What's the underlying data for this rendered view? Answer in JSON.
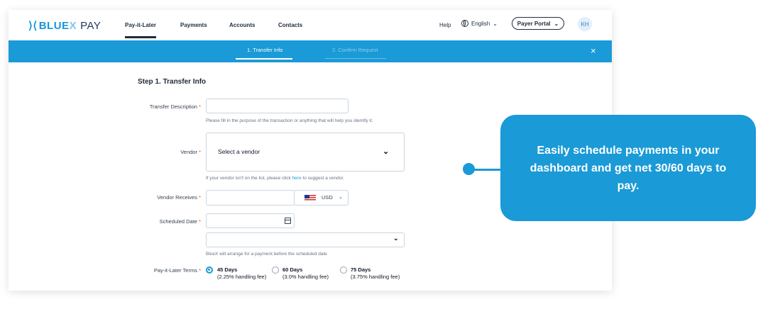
{
  "brand": {
    "name_blue": "BLUE",
    "name_x": "X",
    "name_pay": "PAY"
  },
  "nav": {
    "items": [
      {
        "label": "Pay-it-Later"
      },
      {
        "label": "Payments"
      },
      {
        "label": "Accounts"
      },
      {
        "label": "Contacts"
      }
    ],
    "help": "Help",
    "language": "English",
    "payer_portal": "Payer Portal",
    "avatar_initials": "KH"
  },
  "stepper": {
    "steps": [
      {
        "label": "1. Transfer Info"
      },
      {
        "label": "2. Confirm Request"
      }
    ],
    "close": "×"
  },
  "form": {
    "heading": "Step 1. Transfer Info",
    "transfer_description": {
      "label": "Transfer Description",
      "value": "",
      "hint": "Please fill in the purpose of the transaction or anything that will help you identify it."
    },
    "vendor": {
      "label": "Vendor",
      "placeholder": "Select a vendor",
      "hint_prefix": "If your vendor isn't on the list, please click",
      "hint_link": "here",
      "hint_suffix": "to suggest a vendor."
    },
    "vendor_receives": {
      "label": "Vendor Receives",
      "value": "",
      "currency": "USD"
    },
    "scheduled_date": {
      "label": "Scheduled Date",
      "value": "",
      "select_value": "",
      "hint": "BlueX will arrange for a payment before the scheduled date"
    },
    "terms": {
      "label": "Pay-it-Later Terms",
      "options": [
        {
          "title": "45 Days",
          "sub": "(2.25% handling fee)",
          "selected": true
        },
        {
          "title": "60 Days",
          "sub": "(3.0% handling fee)",
          "selected": false
        },
        {
          "title": "75 Days",
          "sub": "(3.75% handling fee)",
          "selected": false
        }
      ]
    },
    "required_mark": "*"
  },
  "callout": {
    "text": "Easily schedule payments in your dashboard and get net 30/60 days to pay."
  },
  "colors": {
    "accent": "#1a9ad6",
    "navy": "#1f2d3d"
  }
}
